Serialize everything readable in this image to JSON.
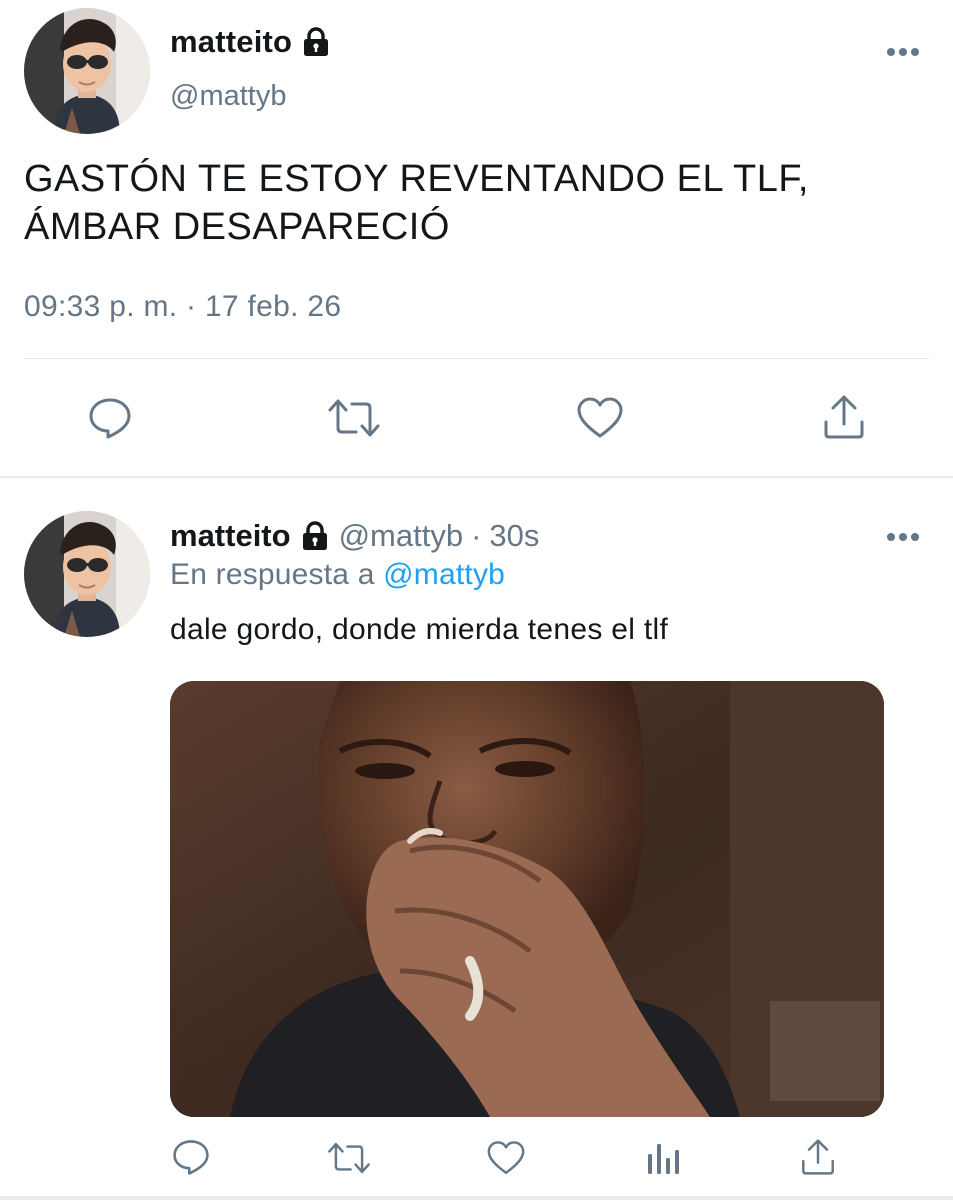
{
  "main_tweet": {
    "display_name": "matteito",
    "handle": "@mattyb",
    "text_line1": "GASTÓN TE ESTOY REVENTANDO EL TLF,",
    "text_line2": "ÁMBAR DESAPARECIÓ",
    "timestamp": "09:33 p. m. · 17 feb. 26",
    "actions": [
      "reply-icon",
      "retweet-icon",
      "like-icon",
      "share-icon"
    ]
  },
  "reply_tweet": {
    "display_name": "matteito",
    "handle": "@mattyb",
    "age_separator": "·",
    "age": "30s",
    "reply_to_prefix": "En respuesta a",
    "reply_to_mention": "@mattyb",
    "text": "dale gordo, donde mierda tenes el tlf",
    "media_icon": "crying-man-meme-image",
    "actions": [
      "reply-icon",
      "retweet-icon",
      "like-icon",
      "analytics-icon",
      "share-icon"
    ]
  },
  "colors": {
    "text_primary": "#14171a",
    "text_secondary": "#657786",
    "link": "#1da1f2",
    "divider": "#e1e8ed"
  }
}
